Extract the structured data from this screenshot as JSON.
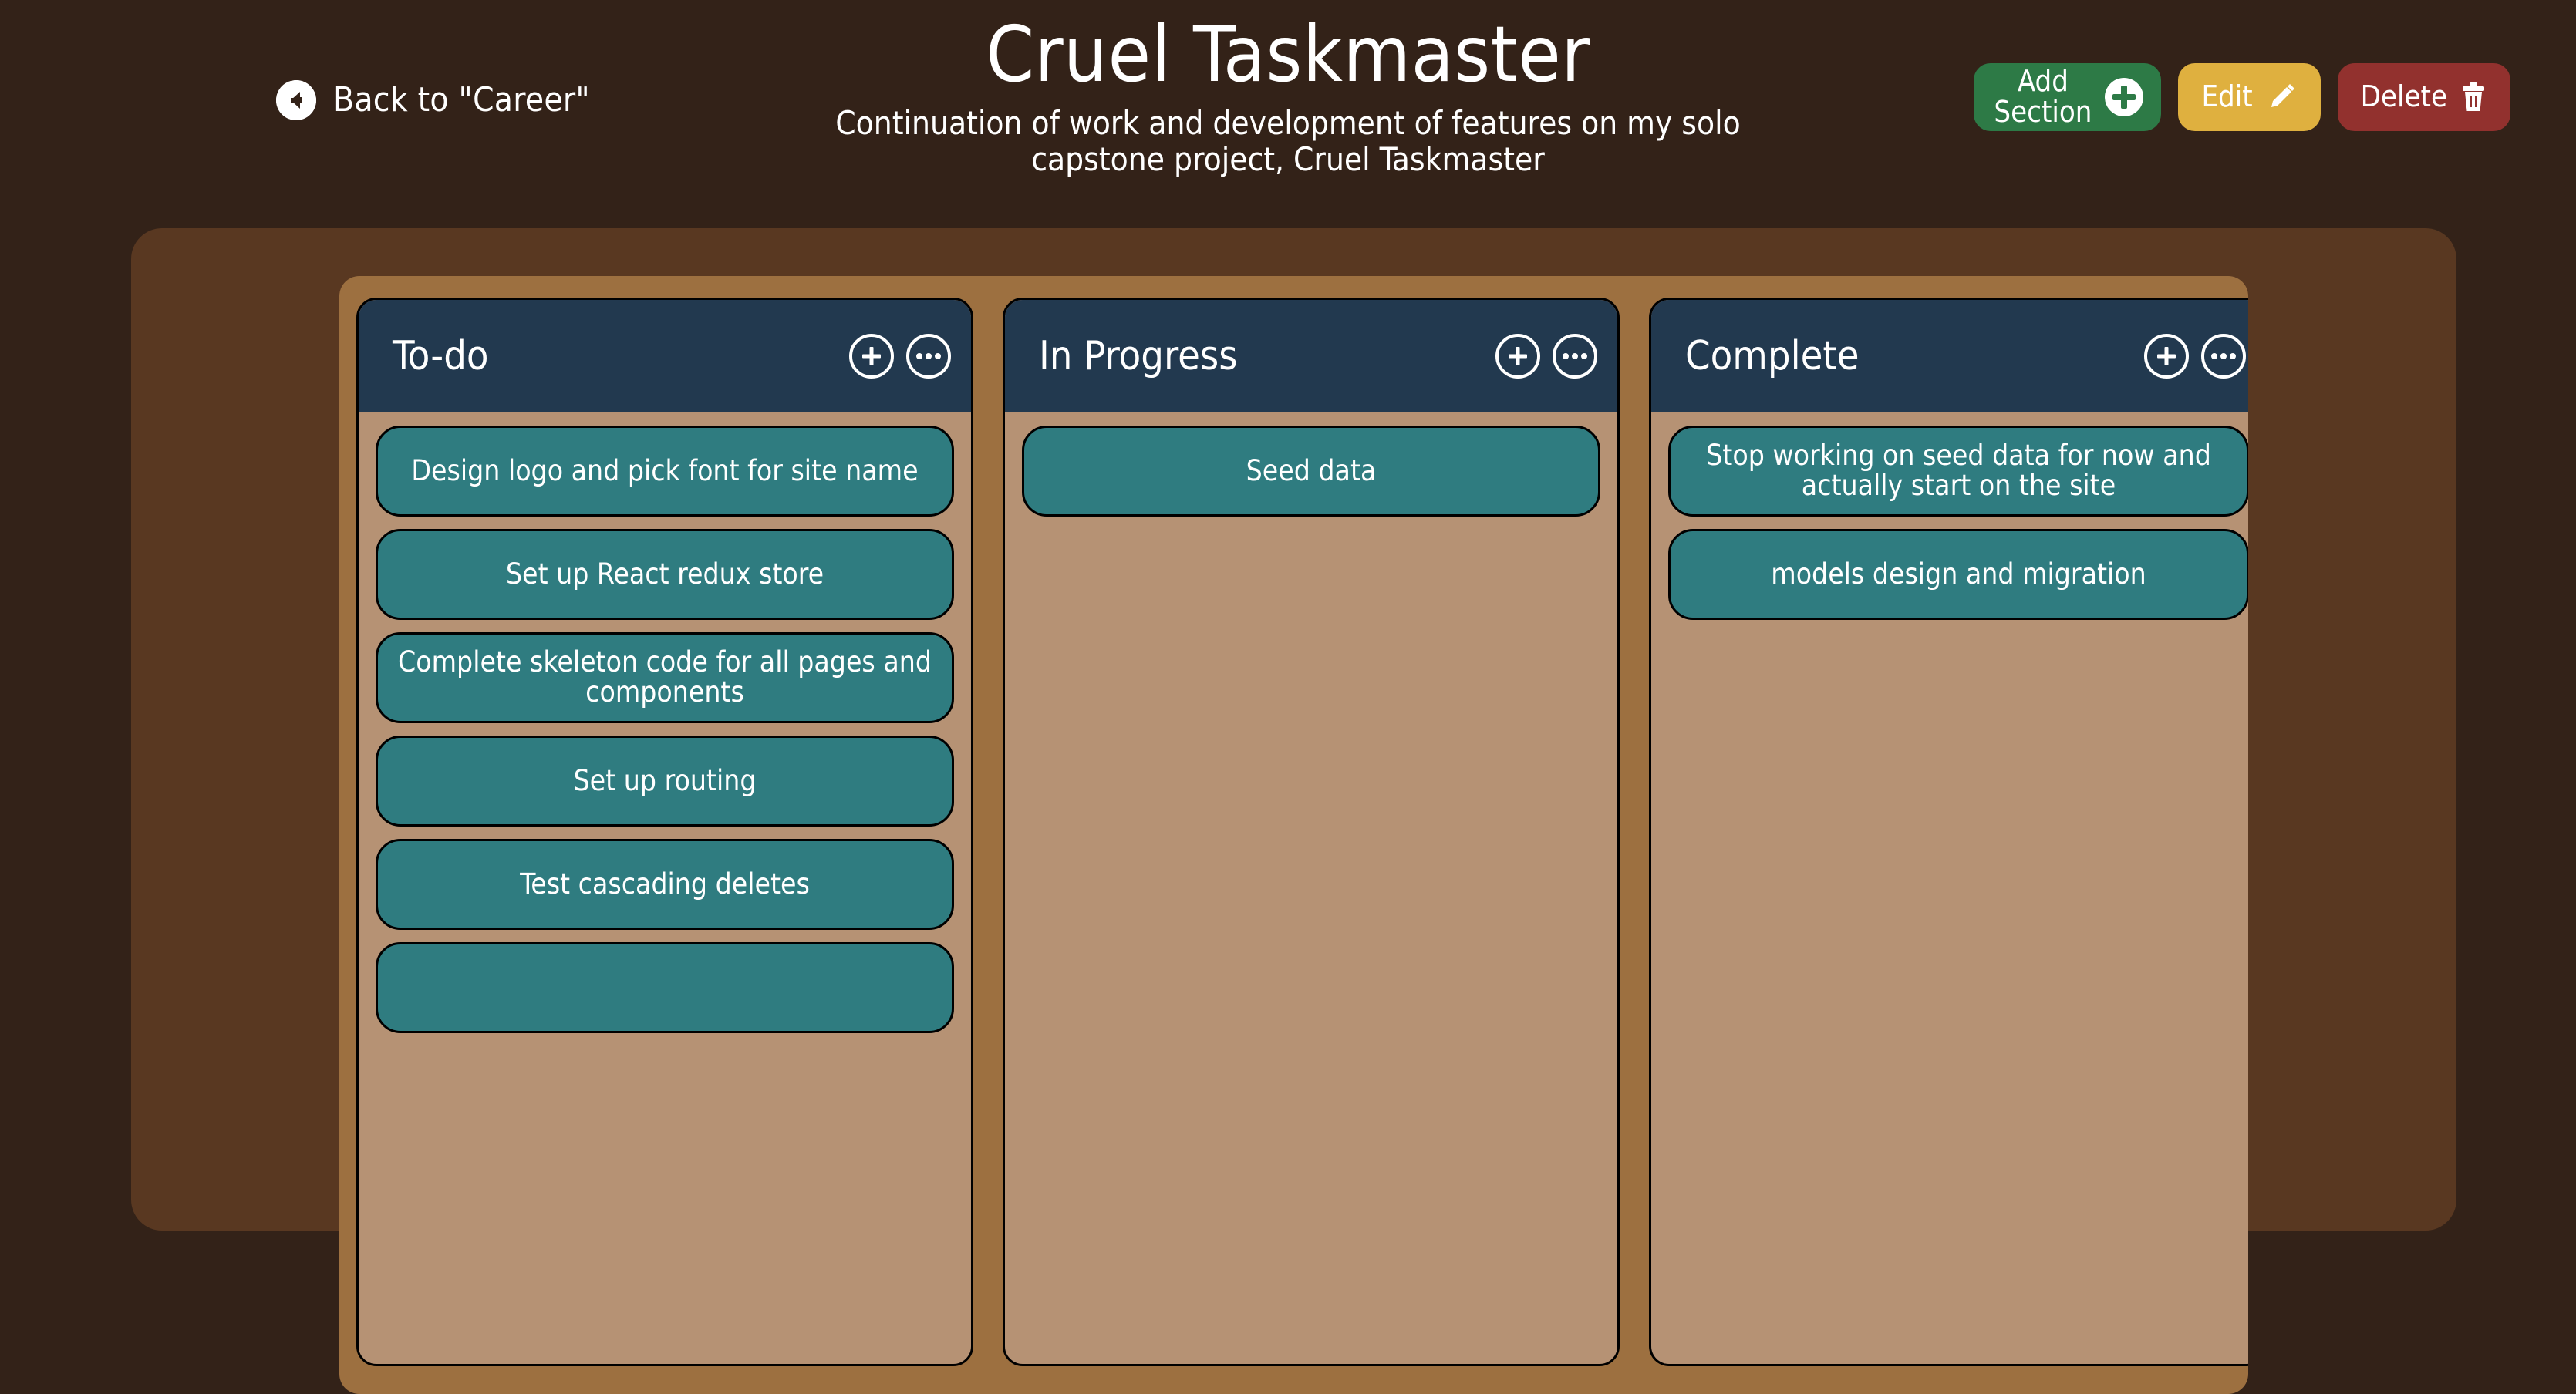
{
  "header": {
    "back_label": "Back to \"Career\"",
    "back_icon": "arrow-left-circle-icon",
    "title": "Cruel Taskmaster",
    "subtitle": "Continuation of work and development of features on my solo capstone project, Cruel Taskmaster",
    "buttons": [
      {
        "label": "Add\nSection",
        "icon": "plus-circle-icon",
        "color": "#2d7a46",
        "name": "add-section-button"
      },
      {
        "label": "Edit",
        "icon": "pencil-icon",
        "color": "#dfb03f",
        "name": "edit-button"
      },
      {
        "label": "Delete",
        "icon": "trash-icon",
        "color": "#92312e",
        "name": "delete-button"
      }
    ]
  },
  "board": {
    "columns": [
      {
        "title": "To-do",
        "add_icon": "plus-circle-icon",
        "menu_icon": "ellipsis-circle-icon",
        "tasks": [
          "Design logo and pick font for site name",
          "Set up React redux store",
          "Complete skeleton code for all pages and components",
          "Set up routing",
          "Test cascading deletes",
          ""
        ]
      },
      {
        "title": "In Progress",
        "add_icon": "plus-circle-icon",
        "menu_icon": "ellipsis-circle-icon",
        "tasks": [
          "Seed data"
        ]
      },
      {
        "title": "Complete",
        "add_icon": "plus-circle-icon",
        "menu_icon": "ellipsis-circle-icon",
        "tasks": [
          "Stop working on seed data for now and actually start on the site",
          "models design and migration"
        ]
      }
    ]
  },
  "colors": {
    "page_background": "#332218",
    "outer_panel": "#593821",
    "board": "#9d7040",
    "column_body": "#b69274",
    "column_header": "#22394f",
    "task_card": "#2f7c80",
    "text_light": "#ffffff"
  }
}
